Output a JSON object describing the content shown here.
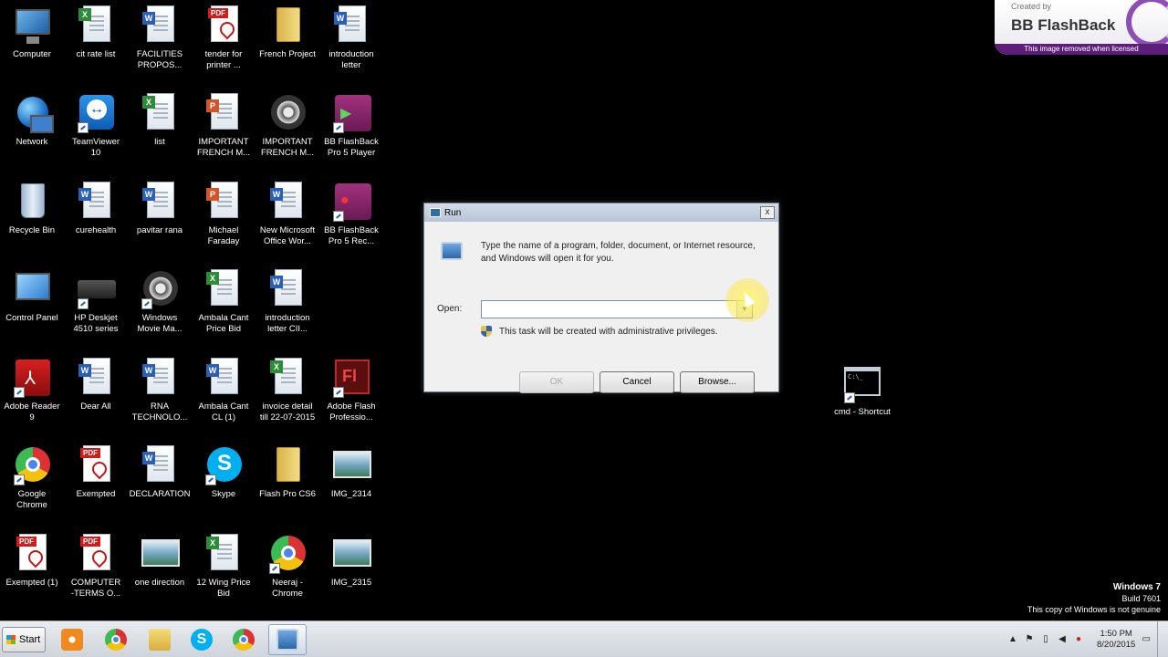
{
  "desktop": {
    "icons": [
      {
        "label": "Computer",
        "type": "monitor",
        "shortcut": false
      },
      {
        "label": "cit rate list",
        "type": "excel",
        "shortcut": false
      },
      {
        "label": "FACILITIES\nPROPOS...",
        "type": "word",
        "shortcut": false
      },
      {
        "label": "tender for\nprinter ...",
        "type": "pdf",
        "shortcut": false
      },
      {
        "label": "French Project",
        "type": "folder",
        "shortcut": false
      },
      {
        "label": "introduction\nletter",
        "type": "word",
        "shortcut": false
      },
      {
        "label": "Network",
        "type": "globe",
        "shortcut": false
      },
      {
        "label": "TeamViewer\n10",
        "type": "teamviewer",
        "shortcut": true
      },
      {
        "label": "list",
        "type": "excel",
        "shortcut": false
      },
      {
        "label": "IMPORTANT\nFRENCH M...",
        "type": "ppt",
        "shortcut": false
      },
      {
        "label": "IMPORTANT\nFRENCH M...",
        "type": "film",
        "shortcut": false
      },
      {
        "label": "BB FlashBack\nPro 5 Player",
        "type": "bbplayer",
        "shortcut": true
      },
      {
        "label": "Recycle Bin",
        "type": "recycle",
        "shortcut": false
      },
      {
        "label": "curehealth",
        "type": "word",
        "shortcut": false
      },
      {
        "label": "pavitar rana",
        "type": "word",
        "shortcut": false
      },
      {
        "label": "Michael\nFaraday",
        "type": "ppt",
        "shortcut": false
      },
      {
        "label": "New Microsoft\nOffice Wor...",
        "type": "word",
        "shortcut": false
      },
      {
        "label": "BB FlashBack\nPro 5 Rec...",
        "type": "bbrec",
        "shortcut": true
      },
      {
        "label": "Control Panel",
        "type": "cpanel",
        "shortcut": false
      },
      {
        "label": "HP Deskjet\n4510 series",
        "type": "printer",
        "shortcut": true
      },
      {
        "label": "Windows\nMovie Ma...",
        "type": "film",
        "shortcut": true
      },
      {
        "label": "Ambala Cant\nPrice Bid",
        "type": "excel",
        "shortcut": false
      },
      {
        "label": "introduction\nletter CII...",
        "type": "word",
        "shortcut": false
      },
      {
        "label": "",
        "type": "none",
        "shortcut": false
      },
      {
        "label": "Adobe Reader\n9",
        "type": "acrobat",
        "shortcut": true
      },
      {
        "label": "Dear All",
        "type": "word",
        "shortcut": false
      },
      {
        "label": "RNA\nTECHNOLO...",
        "type": "word",
        "shortcut": false
      },
      {
        "label": "Ambala Cant\nCL (1)",
        "type": "word",
        "shortcut": false
      },
      {
        "label": "invoice detail\ntill 22-07-2015",
        "type": "excel",
        "shortcut": false
      },
      {
        "label": "Adobe Flash\nProfessio...",
        "type": "flash",
        "shortcut": true
      },
      {
        "label": "Google\nChrome",
        "type": "chrome",
        "shortcut": true
      },
      {
        "label": "Exempted",
        "type": "pdf",
        "shortcut": false
      },
      {
        "label": "DECLARATION",
        "type": "word",
        "shortcut": false
      },
      {
        "label": "Skype",
        "type": "skype",
        "shortcut": true
      },
      {
        "label": "Flash Pro CS6",
        "type": "folder",
        "shortcut": false
      },
      {
        "label": "IMG_2314",
        "type": "image",
        "shortcut": false
      },
      {
        "label": "Exempted (1)",
        "type": "pdf",
        "shortcut": false
      },
      {
        "label": "COMPUTER\n-TERMS O...",
        "type": "pdf",
        "shortcut": false
      },
      {
        "label": "one direction",
        "type": "image",
        "shortcut": false
      },
      {
        "label": "12 Wing Price\nBid",
        "type": "excel",
        "shortcut": false
      },
      {
        "label": "Neeraj -\nChrome",
        "type": "chrome",
        "shortcut": true
      },
      {
        "label": "IMG_2315",
        "type": "image",
        "shortcut": false
      }
    ],
    "cmd_shortcut": {
      "label": "cmd - Shortcut",
      "type": "cmd"
    }
  },
  "run_dialog": {
    "title": "Run",
    "description": "Type the name of a program, folder, document, or Internet resource, and Windows will open it for you.",
    "open_label": "Open:",
    "open_value": "",
    "admin_note": "This task will be created with administrative privileges.",
    "ok_label": "OK",
    "cancel_label": "Cancel",
    "browse_label": "Browse...",
    "close_glyph": "x",
    "dropdown_glyph": "▼"
  },
  "watermark": {
    "created_by": "Created by",
    "brand": "BB FlashBack",
    "note": "This image removed when licensed"
  },
  "windows_notice": {
    "edition": "Windows 7",
    "build": "Build 7601",
    "genuine": "This copy of Windows is not genuine"
  },
  "taskbar": {
    "start_label": "Start",
    "apps": [
      {
        "name": "windows-media-player",
        "glyph_class": "g-media",
        "active": false,
        "text": ""
      },
      {
        "name": "google-chrome",
        "glyph_class": "g-chrome",
        "active": false,
        "text": ""
      },
      {
        "name": "windows-explorer",
        "glyph_class": "g-folder",
        "active": false,
        "text": ""
      },
      {
        "name": "skype",
        "glyph_class": "g-skype",
        "active": false,
        "text": "S"
      },
      {
        "name": "google-chrome-2",
        "glyph_class": "g-chrome",
        "active": false,
        "text": ""
      },
      {
        "name": "run",
        "glyph_class": "g-run",
        "active": true,
        "text": ""
      }
    ],
    "tray": {
      "arrow": "▲",
      "time": "1:50 PM",
      "date": "8/20/2015"
    }
  }
}
